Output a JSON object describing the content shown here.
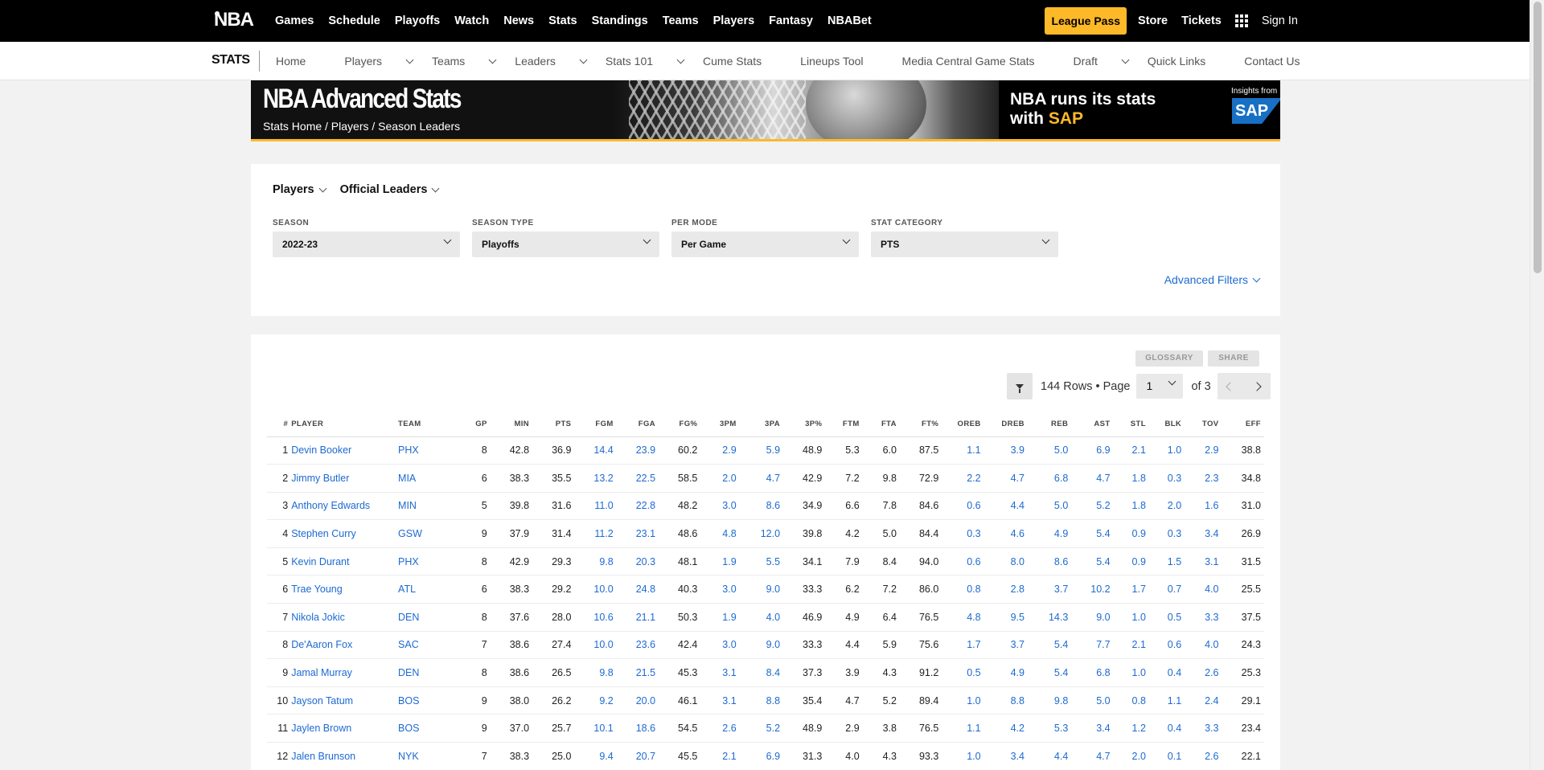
{
  "topnav": {
    "logo_text": "NBA",
    "links": [
      "Games",
      "Schedule",
      "Playoffs",
      "Watch",
      "News",
      "Stats",
      "Standings",
      "Teams",
      "Players",
      "Fantasy",
      "NBABet"
    ],
    "league_pass": "League Pass",
    "store": "Store",
    "tickets": "Tickets",
    "sign_in": "Sign In",
    "apps_icon": "grid-icon"
  },
  "subnav": {
    "brand": "STATS",
    "links": [
      {
        "label": "Home",
        "dropdown": false
      },
      {
        "label": "Players",
        "dropdown": true
      },
      {
        "label": "Teams",
        "dropdown": true
      },
      {
        "label": "Leaders",
        "dropdown": true
      },
      {
        "label": "Stats 101",
        "dropdown": true
      },
      {
        "label": "Cume Stats",
        "dropdown": false
      },
      {
        "label": "Lineups Tool",
        "dropdown": false
      },
      {
        "label": "Media Central Game Stats",
        "dropdown": false
      },
      {
        "label": "Draft",
        "dropdown": true
      },
      {
        "label": "Quick Links",
        "dropdown": false
      },
      {
        "label": "Contact Us",
        "dropdown": false
      }
    ]
  },
  "banner": {
    "title": "NBA Advanced Stats",
    "breadcrumb": "Stats Home / Players / Season Leaders",
    "ad_line1": "NBA runs its stats",
    "ad_line2_prefix": "with ",
    "ad_line2_brand": "SAP",
    "insights": "Insights from",
    "sap_logo": "SAP"
  },
  "filters": {
    "top_dropdowns": [
      "Players",
      "Official Leaders"
    ],
    "groups": [
      {
        "label": "SEASON",
        "value": "2022-23"
      },
      {
        "label": "SEASON TYPE",
        "value": "Playoffs"
      },
      {
        "label": "PER MODE",
        "value": "Per Game"
      },
      {
        "label": "STAT CATEGORY",
        "value": "PTS"
      }
    ],
    "advanced": "Advanced Filters"
  },
  "table_toolbar": {
    "glossary": "GLOSSARY",
    "share": "SHARE",
    "rows_text": "144 Rows • Page",
    "page_value": "1",
    "of_text": "of 3"
  },
  "table": {
    "columns": [
      "#",
      "PLAYER",
      "TEAM",
      "GP",
      "MIN",
      "PTS",
      "FGM",
      "FGA",
      "FG%",
      "3PM",
      "3PA",
      "3P%",
      "FTM",
      "FTA",
      "FT%",
      "OREB",
      "DREB",
      "REB",
      "AST",
      "STL",
      "BLK",
      "TOV",
      "EFF"
    ],
    "rows": [
      [
        "1",
        "Devin Booker",
        "PHX",
        "8",
        "42.8",
        "36.9",
        "14.4",
        "23.9",
        "60.2",
        "2.9",
        "5.9",
        "48.9",
        "5.3",
        "6.0",
        "87.5",
        "1.1",
        "3.9",
        "5.0",
        "6.9",
        "2.1",
        "1.0",
        "2.9",
        "38.8"
      ],
      [
        "2",
        "Jimmy Butler",
        "MIA",
        "6",
        "38.3",
        "35.5",
        "13.2",
        "22.5",
        "58.5",
        "2.0",
        "4.7",
        "42.9",
        "7.2",
        "9.8",
        "72.9",
        "2.2",
        "4.7",
        "6.8",
        "4.7",
        "1.8",
        "0.3",
        "2.3",
        "34.8"
      ],
      [
        "3",
        "Anthony Edwards",
        "MIN",
        "5",
        "39.8",
        "31.6",
        "11.0",
        "22.8",
        "48.2",
        "3.0",
        "8.6",
        "34.9",
        "6.6",
        "7.8",
        "84.6",
        "0.6",
        "4.4",
        "5.0",
        "5.2",
        "1.8",
        "2.0",
        "1.6",
        "31.0"
      ],
      [
        "4",
        "Stephen Curry",
        "GSW",
        "9",
        "37.9",
        "31.4",
        "11.2",
        "23.1",
        "48.6",
        "4.8",
        "12.0",
        "39.8",
        "4.2",
        "5.0",
        "84.4",
        "0.3",
        "4.6",
        "4.9",
        "5.4",
        "0.9",
        "0.3",
        "3.4",
        "26.9"
      ],
      [
        "5",
        "Kevin Durant",
        "PHX",
        "8",
        "42.9",
        "29.3",
        "9.8",
        "20.3",
        "48.1",
        "1.9",
        "5.5",
        "34.1",
        "7.9",
        "8.4",
        "94.0",
        "0.6",
        "8.0",
        "8.6",
        "5.4",
        "0.9",
        "1.5",
        "3.1",
        "31.5"
      ],
      [
        "6",
        "Trae Young",
        "ATL",
        "6",
        "38.3",
        "29.2",
        "10.0",
        "24.8",
        "40.3",
        "3.0",
        "9.0",
        "33.3",
        "6.2",
        "7.2",
        "86.0",
        "0.8",
        "2.8",
        "3.7",
        "10.2",
        "1.7",
        "0.7",
        "4.0",
        "25.5"
      ],
      [
        "7",
        "Nikola Jokic",
        "DEN",
        "8",
        "37.6",
        "28.0",
        "10.6",
        "21.1",
        "50.3",
        "1.9",
        "4.0",
        "46.9",
        "4.9",
        "6.4",
        "76.5",
        "4.8",
        "9.5",
        "14.3",
        "9.0",
        "1.0",
        "0.5",
        "3.3",
        "37.5"
      ],
      [
        "8",
        "De'Aaron Fox",
        "SAC",
        "7",
        "38.6",
        "27.4",
        "10.0",
        "23.6",
        "42.4",
        "3.0",
        "9.0",
        "33.3",
        "4.4",
        "5.9",
        "75.6",
        "1.7",
        "3.7",
        "5.4",
        "7.7",
        "2.1",
        "0.6",
        "4.0",
        "24.3"
      ],
      [
        "9",
        "Jamal Murray",
        "DEN",
        "8",
        "38.6",
        "26.5",
        "9.8",
        "21.5",
        "45.3",
        "3.1",
        "8.4",
        "37.3",
        "3.9",
        "4.3",
        "91.2",
        "0.5",
        "4.9",
        "5.4",
        "6.8",
        "1.0",
        "0.4",
        "2.6",
        "25.3"
      ],
      [
        "10",
        "Jayson Tatum",
        "BOS",
        "9",
        "38.0",
        "26.2",
        "9.2",
        "20.0",
        "46.1",
        "3.1",
        "8.8",
        "35.4",
        "4.7",
        "5.2",
        "89.4",
        "1.0",
        "8.8",
        "9.8",
        "5.0",
        "0.8",
        "1.1",
        "2.4",
        "29.1"
      ],
      [
        "11",
        "Jaylen Brown",
        "BOS",
        "9",
        "37.0",
        "25.7",
        "10.1",
        "18.6",
        "54.5",
        "2.6",
        "5.2",
        "48.9",
        "2.9",
        "3.8",
        "76.5",
        "1.1",
        "4.2",
        "5.3",
        "3.4",
        "1.2",
        "0.4",
        "3.3",
        "23.4"
      ],
      [
        "12",
        "Jalen Brunson",
        "NYK",
        "7",
        "38.3",
        "25.0",
        "9.4",
        "20.7",
        "45.5",
        "2.1",
        "6.9",
        "31.3",
        "4.0",
        "4.3",
        "93.3",
        "1.0",
        "3.4",
        "4.4",
        "4.7",
        "2.0",
        "0.1",
        "2.6",
        "22.1"
      ]
    ],
    "link_columns": [
      1,
      2,
      6,
      7,
      9,
      10,
      15,
      16,
      17,
      18,
      19,
      20,
      21
    ],
    "link_color": "#1d6ad1"
  },
  "colors": {
    "accent_gold": "#fdb927",
    "link_blue": "#1d6ad1",
    "nav_black": "#000000"
  }
}
